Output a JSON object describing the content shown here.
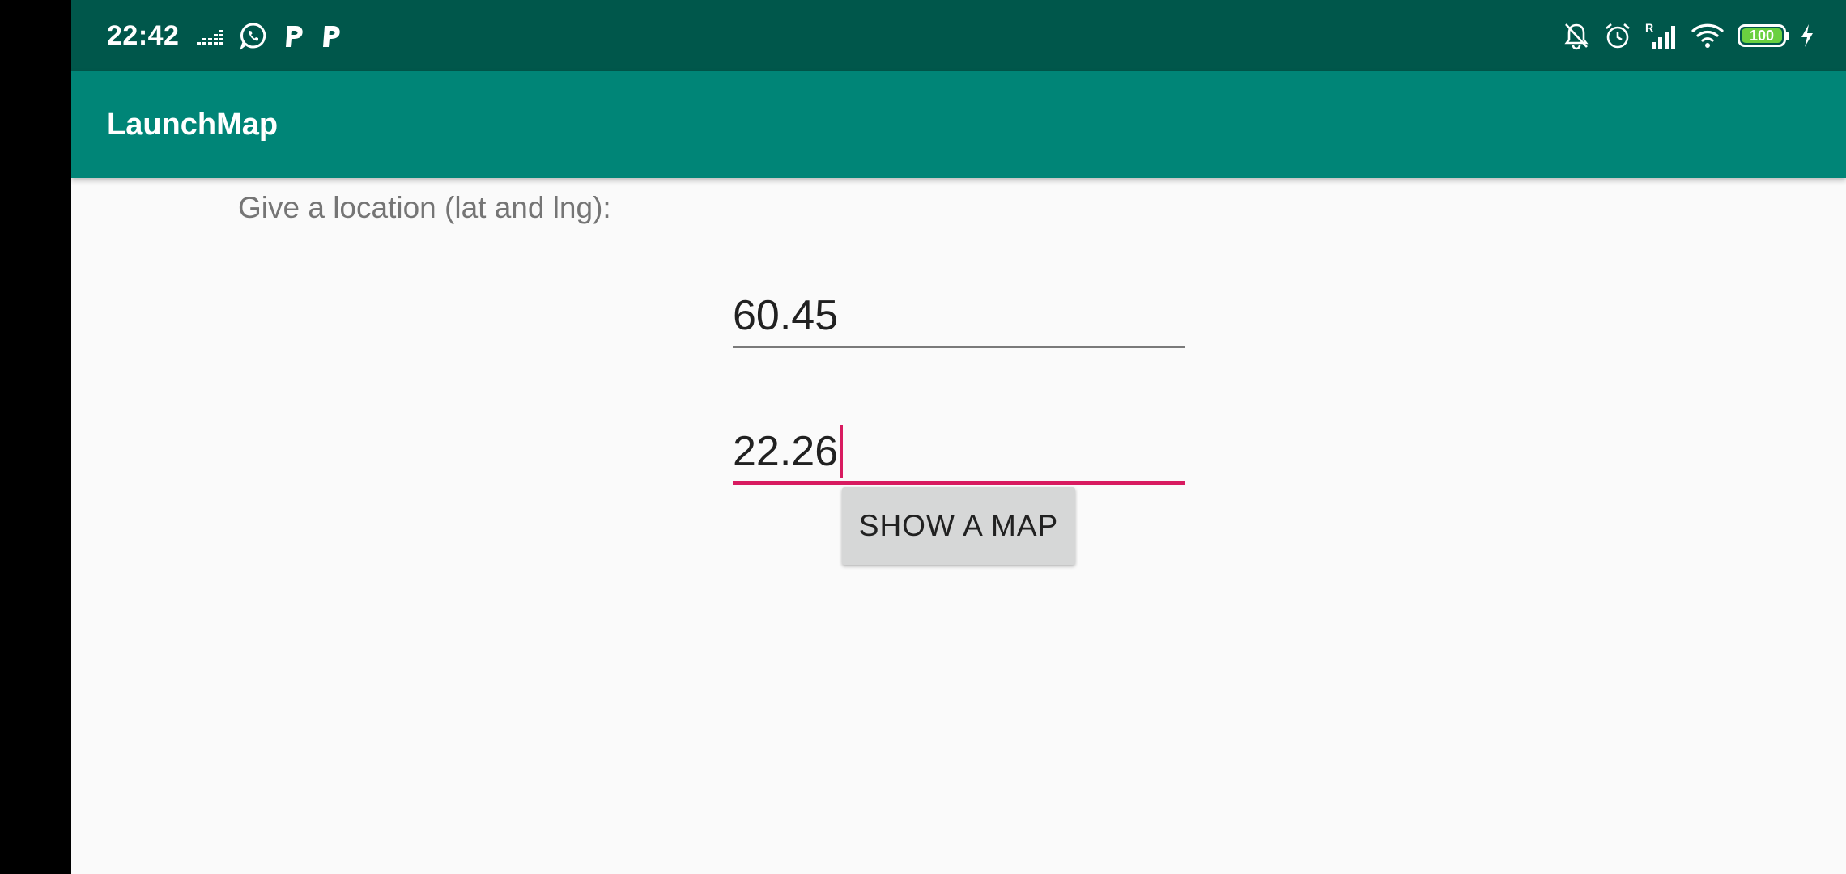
{
  "status_bar": {
    "time": "22:42",
    "left_icons": [
      "equalizer-icon",
      "whatsapp-icon",
      "p-app-icon",
      "p-app-icon"
    ],
    "right_icons": [
      "bell-off-icon",
      "alarm-icon",
      "signal-icon",
      "wifi-icon",
      "battery-icon",
      "charging-icon"
    ],
    "signal_roaming_label": "R",
    "battery_level": "100",
    "p_app_label": "P"
  },
  "toolbar": {
    "title": "LaunchMap"
  },
  "form": {
    "prompt": "Give a location (lat and lng):",
    "latitude_value": "60.45",
    "longitude_value": "22.26",
    "button_label": "SHOW A MAP"
  },
  "colors": {
    "status_bar": "#00574b",
    "toolbar": "#008577",
    "accent": "#d81b60",
    "background": "#fafafa",
    "button": "#d6d7d7",
    "battery_fill": "#6ad040"
  }
}
